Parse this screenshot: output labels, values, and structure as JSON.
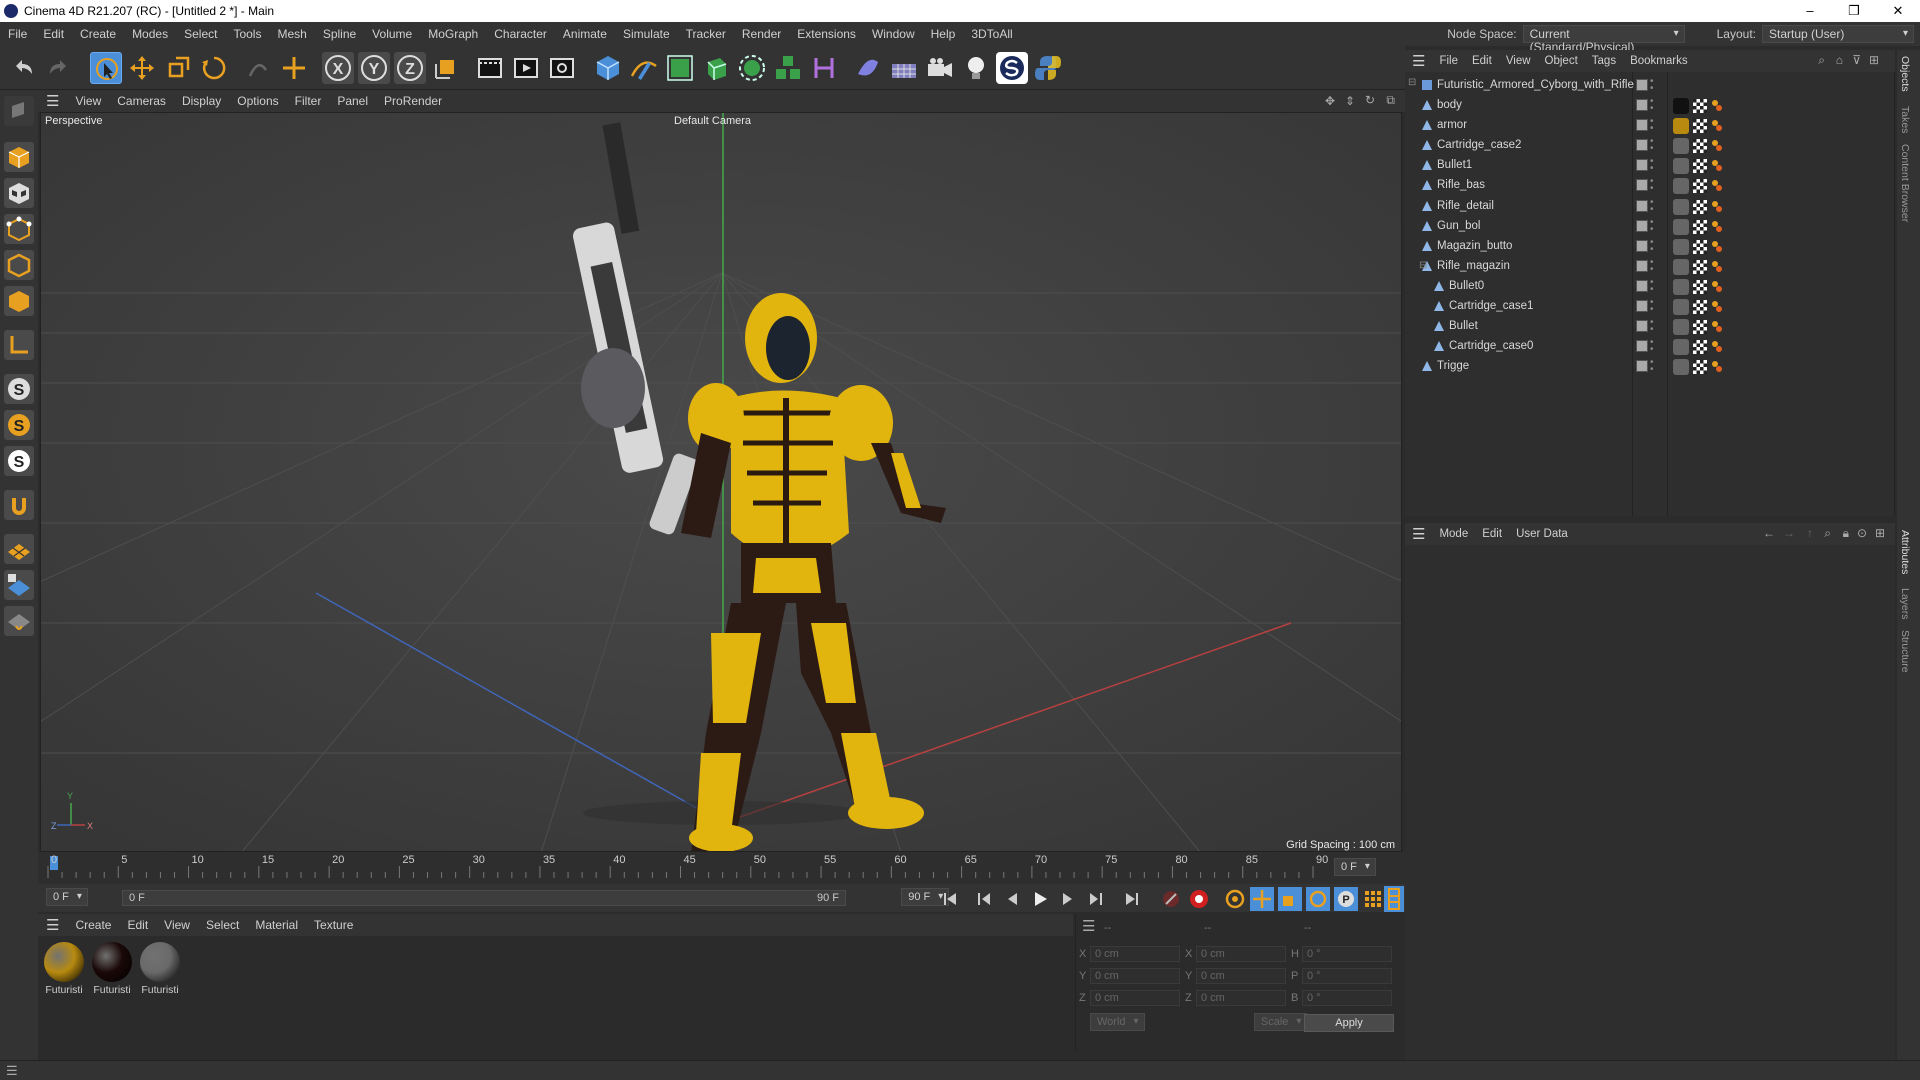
{
  "window": {
    "title": "Cinema 4D R21.207 (RC) - [Untitled 2 *] - Main",
    "controls": [
      "–",
      "❐",
      "✕"
    ]
  },
  "menubar": {
    "items": [
      "File",
      "Edit",
      "Create",
      "Modes",
      "Select",
      "Tools",
      "Mesh",
      "Spline",
      "Volume",
      "MoGraph",
      "Character",
      "Animate",
      "Simulate",
      "Tracker",
      "Render",
      "Extensions",
      "Window",
      "Help",
      "3DToAll"
    ],
    "node_space_label": "Node Space:",
    "node_space_value": "Current (Standard/Physical)",
    "layout_label": "Layout:",
    "layout_value": "Startup (User)"
  },
  "toolbar": {
    "axis_x": "X",
    "axis_y": "Y",
    "axis_z": "Z"
  },
  "viewport": {
    "menu": [
      "View",
      "Cameras",
      "Display",
      "Options",
      "Filter",
      "Panel",
      "ProRender"
    ],
    "label": "Perspective",
    "camera": "Default Camera",
    "grid_spacing": "Grid Spacing : 100 cm",
    "axis_y": "Y",
    "axis_z": "Z",
    "axis_x": "X"
  },
  "timeline": {
    "ticks": [
      "0",
      "5",
      "10",
      "15",
      "20",
      "25",
      "30",
      "35",
      "40",
      "45",
      "50",
      "55",
      "60",
      "65",
      "70",
      "75",
      "80",
      "85",
      "90"
    ],
    "current_frame": "0 F",
    "start_field": "0 F",
    "range_start": "0 F",
    "range_end": "90 F",
    "end_field": "90 F"
  },
  "material_manager": {
    "menu": [
      "Create",
      "Edit",
      "View",
      "Select",
      "Material",
      "Texture"
    ],
    "materials": [
      {
        "name": "Futuristi",
        "color": "#b88a10"
      },
      {
        "name": "Futuristi",
        "color": "#1a0808"
      },
      {
        "name": "Futuristi",
        "color": "#6a6a6a"
      }
    ]
  },
  "coordinates": {
    "headers": [
      "--",
      "--",
      "--"
    ],
    "rows": [
      {
        "a": "X",
        "av": "0 cm",
        "b": "X",
        "bv": "0 cm",
        "c": "H",
        "cv": "0 °"
      },
      {
        "a": "Y",
        "av": "0 cm",
        "b": "Y",
        "bv": "0 cm",
        "c": "P",
        "cv": "0 °"
      },
      {
        "a": "Z",
        "av": "0 cm",
        "b": "Z",
        "bv": "0 cm",
        "c": "B",
        "cv": "0 °"
      }
    ],
    "mode1": "World",
    "mode2": "Scale",
    "apply": "Apply"
  },
  "object_manager": {
    "menu": [
      "File",
      "Edit",
      "View",
      "Object",
      "Tags",
      "Bookmarks"
    ],
    "root": "Futuristic_Armored_Cyborg_with_Rifle",
    "objects": [
      {
        "name": "body",
        "indent": 1,
        "mat": "#111111"
      },
      {
        "name": "armor",
        "indent": 1,
        "mat": "#b88a10"
      },
      {
        "name": "Cartridge_case2",
        "indent": 1,
        "mat": "#666666"
      },
      {
        "name": "Bullet1",
        "indent": 1,
        "mat": "#666666"
      },
      {
        "name": "Rifle_bas",
        "indent": 1,
        "mat": "#666666"
      },
      {
        "name": "Rifle_detail",
        "indent": 1,
        "mat": "#666666"
      },
      {
        "name": "Gun_bol",
        "indent": 1,
        "mat": "#666666"
      },
      {
        "name": "Magazin_butto",
        "indent": 1,
        "mat": "#666666"
      },
      {
        "name": "Rifle_magazin",
        "indent": 1,
        "mat": "#666666"
      },
      {
        "name": "Bullet0",
        "indent": 2,
        "mat": "#666666"
      },
      {
        "name": "Cartridge_case1",
        "indent": 2,
        "mat": "#666666"
      },
      {
        "name": "Bullet",
        "indent": 2,
        "mat": "#666666"
      },
      {
        "name": "Cartridge_case0",
        "indent": 2,
        "mat": "#666666"
      },
      {
        "name": "Trigge",
        "indent": 1,
        "mat": "#666666"
      }
    ]
  },
  "attributes": {
    "menu": [
      "Mode",
      "Edit",
      "User Data"
    ]
  },
  "right_tabs": [
    "Objects",
    "Takes",
    "Content Browser",
    "Attributes",
    "Layers",
    "Structure"
  ],
  "colors": {
    "accent_blue": "#4a8fd8",
    "armor_yellow": "#e2b40e",
    "record_red": "#d02020"
  }
}
